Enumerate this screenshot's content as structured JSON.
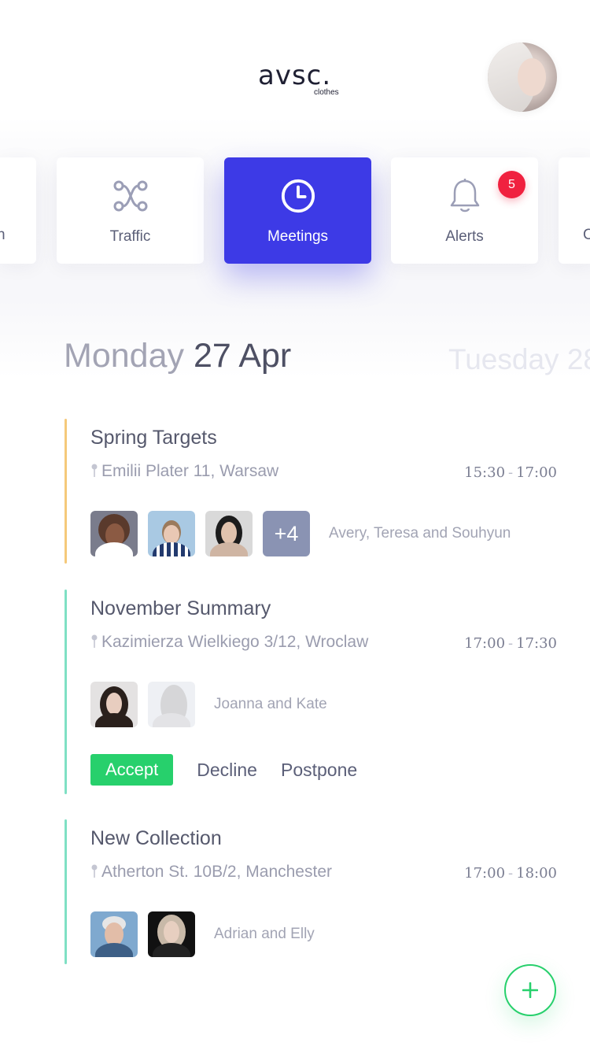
{
  "header": {
    "logo_main": "avsc.",
    "logo_sub": "clothes"
  },
  "tabs": {
    "left_partial_label": "n",
    "right_partial_label": "C",
    "items": [
      {
        "label": "Traffic",
        "icon": "route-icon"
      },
      {
        "label": "Meetings",
        "icon": "clock-icon",
        "active": true
      },
      {
        "label": "Alerts",
        "icon": "bell-icon",
        "badge": "5"
      }
    ]
  },
  "day": {
    "name": "Monday",
    "date": "27 Apr",
    "next": "Tuesday 28"
  },
  "events": [
    {
      "title": "Spring Targets",
      "location": "Emilii Plater 11, Warsaw",
      "time_start": "15:30",
      "time_end": "17:00",
      "more": "+4",
      "attendees": "Avery, Teresa and Souhyun",
      "accent": "#f5c97a"
    },
    {
      "title": "November Summary",
      "location": "Kazimierza Wielkiego 3/12, Wroclaw",
      "time_start": "17:00",
      "time_end": "17:30",
      "attendees": "Joanna and Kate",
      "accent": "#7fe0c4",
      "actions": {
        "accept": "Accept",
        "decline": "Decline",
        "postpone": "Postpone"
      }
    },
    {
      "title": "New Collection",
      "location": "Atherton St. 10B/2, Manchester",
      "time_start": "17:00",
      "time_end": "18:00",
      "attendees": "Adrian and Elly",
      "accent": "#7fe0c4"
    }
  ],
  "colors": {
    "primary": "#3d3ae6",
    "accept": "#27d06c",
    "badge": "#f0213f"
  }
}
